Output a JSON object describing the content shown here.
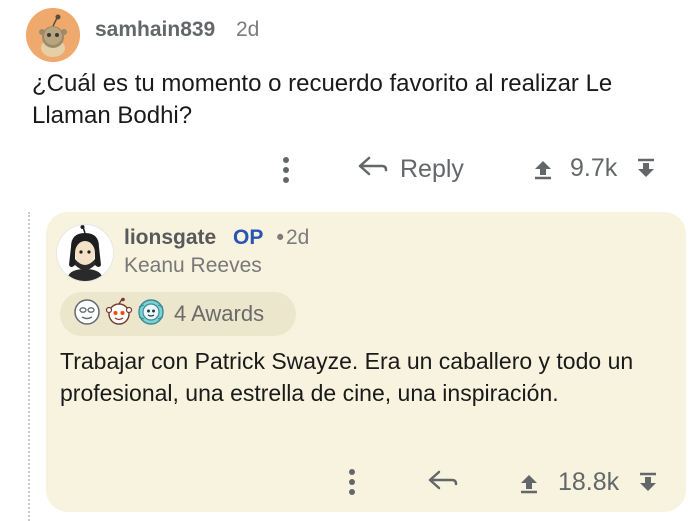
{
  "top_comment": {
    "author": "samhain839",
    "age": "2d",
    "body": "¿Cuál es tu momento o recuerdo favorito al realizar Le Llaman Bodhi?",
    "reply_label": "Reply",
    "score": "9.7k"
  },
  "reply_comment": {
    "author": "lionsgate",
    "op_badge": "OP",
    "separator": "•",
    "age": "2d",
    "flair": "Keanu Reeves",
    "awards_label": "4 Awards",
    "body": "Trabajar con Patrick Swayze. Era un caballero y todo un profesional, una estrella de cine, una inspiración.",
    "score": "18.8k"
  },
  "colors": {
    "card_background": "#f7f3df",
    "op_color": "#2953b5",
    "avatar_orange": "#f0a96d"
  },
  "icons": [
    "snoo-avatar-icon",
    "keanu-avatar-icon",
    "more-options-icon",
    "reply-arrow-icon",
    "upvote-icon",
    "downvote-icon",
    "award-icon"
  ]
}
